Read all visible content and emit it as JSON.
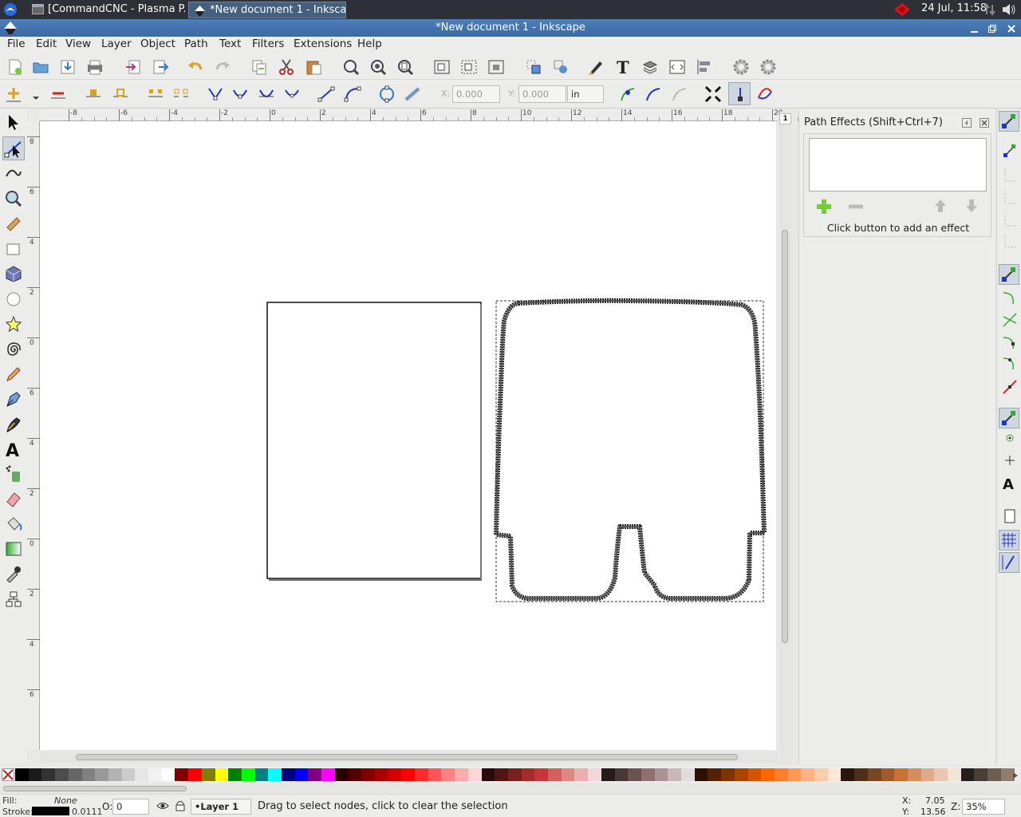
{
  "taskbar": {
    "tasks": [
      {
        "label": "[CommandCNC - Plasma P..."
      },
      {
        "label": "*New document 1 - Inksca..."
      }
    ],
    "datetime": "24 Jul, 11:58"
  },
  "window": {
    "title": "*New document 1 - Inkscape"
  },
  "menu": [
    "File",
    "Edit",
    "View",
    "Layer",
    "Object",
    "Path",
    "Text",
    "Filters",
    "Extensions",
    "Help"
  ],
  "controls": {
    "x_label": "X:",
    "x_value": "0.000",
    "y_label": "Y:",
    "y_value": "0.000",
    "unit": "in"
  },
  "ruler": {
    "h_ticks": [
      "-8",
      "-6",
      "-4",
      "-2",
      "0",
      "2",
      "4",
      "6",
      "8",
      "10",
      "12",
      "14",
      "16",
      "18",
      "20"
    ],
    "v_ticks": [
      "8",
      "6",
      "4",
      "2",
      "0",
      "6",
      "4",
      "2",
      "0",
      "2",
      "4",
      "6"
    ]
  },
  "dock": {
    "title": "Path Effects  (Shift+Ctrl+7)",
    "hint": "Click button to add an effect",
    "page_badge": "1"
  },
  "status": {
    "fill_label": "Fill:",
    "fill_value": "None",
    "stroke_label": "Stroke:",
    "stroke_width": "0.0111",
    "opacity_label": "O:",
    "opacity_value": "0",
    "layer": "•Layer 1",
    "message": "Drag to select nodes, click to clear the selection",
    "x_label": "X:",
    "x_value": "7.05",
    "y_label": "Y:",
    "y_value": "13.56",
    "zoom_label": "Z:",
    "zoom_value": "35%"
  },
  "palette_colors": [
    "#000000",
    "#1a1a1a",
    "#333333",
    "#4d4d4d",
    "#666666",
    "#808080",
    "#999999",
    "#b3b3b3",
    "#cccccc",
    "#e6e6e6",
    "#f2f2f2",
    "#ffffff",
    "#800000",
    "#ff0000",
    "#808000",
    "#ffff00",
    "#008000",
    "#00ff00",
    "#008080",
    "#00ffff",
    "#000080",
    "#0000ff",
    "#800080",
    "#ff00ff",
    "#2b0000",
    "#550000",
    "#800000",
    "#aa0000",
    "#d40000",
    "#ff0000",
    "#ff2a2a",
    "#ff5555",
    "#ff8080",
    "#ffaaaa",
    "#ffd5d5",
    "#280b0b",
    "#501616",
    "#782121",
    "#a02c2c",
    "#c83737",
    "#d35f5f",
    "#de8787",
    "#e9afaf",
    "#f4d7d7",
    "#241c1c",
    "#483737",
    "#6c5353",
    "#916f6f",
    "#ac9393",
    "#c8b7b7",
    "#e3dbdb",
    "#2b1100",
    "#552200",
    "#803300",
    "#aa4400",
    "#d45500",
    "#ff6600",
    "#ff7f2a",
    "#ff9955",
    "#ffb380",
    "#ffccaa",
    "#ffe6d5",
    "#28170b",
    "#502d16",
    "#784421",
    "#a05a2c",
    "#c87137",
    "#d38d5f",
    "#deaa87",
    "#e9c6af",
    "#f4e3d7",
    "#241f1c",
    "#483e37",
    "#6c5d53",
    "#917c6f"
  ]
}
